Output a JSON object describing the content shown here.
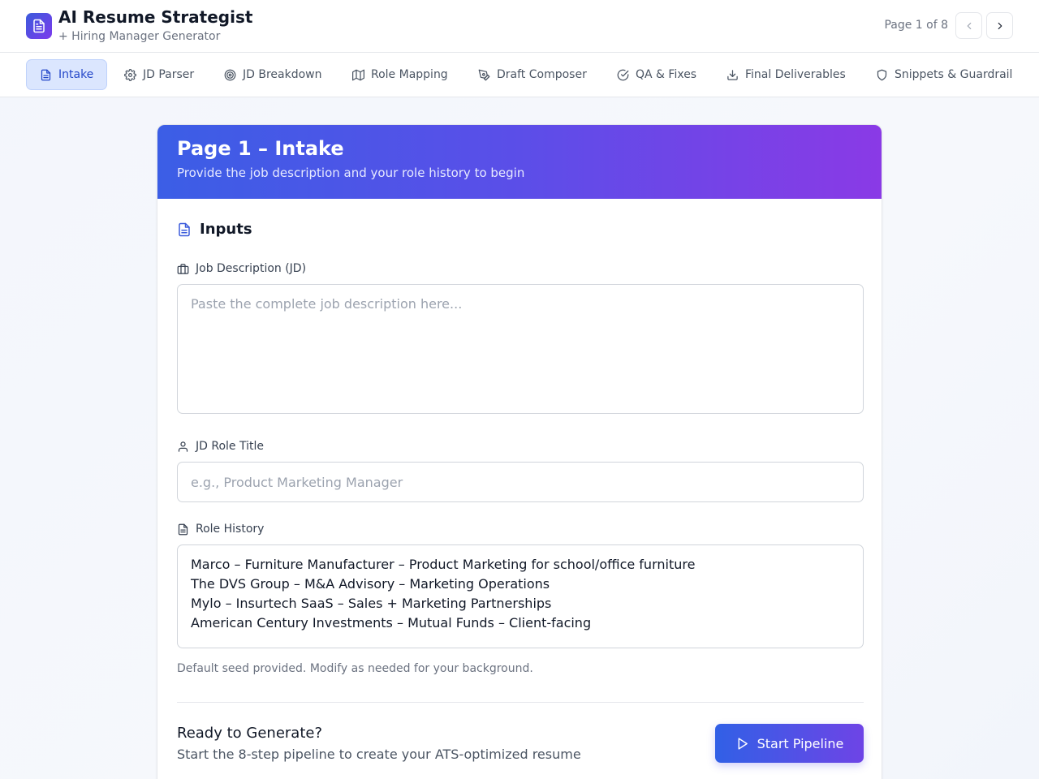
{
  "header": {
    "title": "AI Resume Strategist",
    "subtitle": "+ Hiring Manager Generator",
    "page_indicator": "Page 1 of 8"
  },
  "tabs": [
    {
      "label": "Intake",
      "icon": "document-icon",
      "active": true
    },
    {
      "label": "JD Parser",
      "icon": "gear-icon",
      "active": false
    },
    {
      "label": "JD Breakdown",
      "icon": "target-icon",
      "active": false
    },
    {
      "label": "Role Mapping",
      "icon": "map-icon",
      "active": false
    },
    {
      "label": "Draft Composer",
      "icon": "pen-icon",
      "active": false
    },
    {
      "label": "QA & Fixes",
      "icon": "check-circle-icon",
      "active": false
    },
    {
      "label": "Final Deliverables",
      "icon": "download-icon",
      "active": false
    },
    {
      "label": "Snippets & Guardrail",
      "icon": "shield-icon",
      "active": false
    }
  ],
  "card": {
    "title": "Page 1 – Intake",
    "subtitle": "Provide the job description and your role history to begin",
    "section_title": "Inputs"
  },
  "fields": {
    "jd_label": "Job Description (JD)",
    "jd_placeholder": "Paste the complete job description here...",
    "role_title_label": "JD Role Title",
    "role_title_placeholder": "e.g., Product Marketing Manager",
    "role_history_label": "Role History",
    "role_history_lines": [
      "Marco – Furniture Manufacturer – Product Marketing for school/office furniture",
      "The DVS Group – M&A Advisory – Marketing Operations",
      "Mylo – Insurtech SaaS – Sales + Marketing Partnerships",
      "American Century Investments – Mutual Funds – Client-facing"
    ],
    "hint": "Default seed provided. Modify as needed for your background."
  },
  "footer": {
    "ready_title": "Ready to Generate?",
    "ready_subtitle": "Start the 8-step pipeline to create your ATS-optimized resume",
    "start_button": "Start Pipeline"
  },
  "colors": {
    "accent": "#3b5bdb",
    "gradient_end": "#8a3ae6",
    "active_tab_bg": "#dbe6fe"
  }
}
